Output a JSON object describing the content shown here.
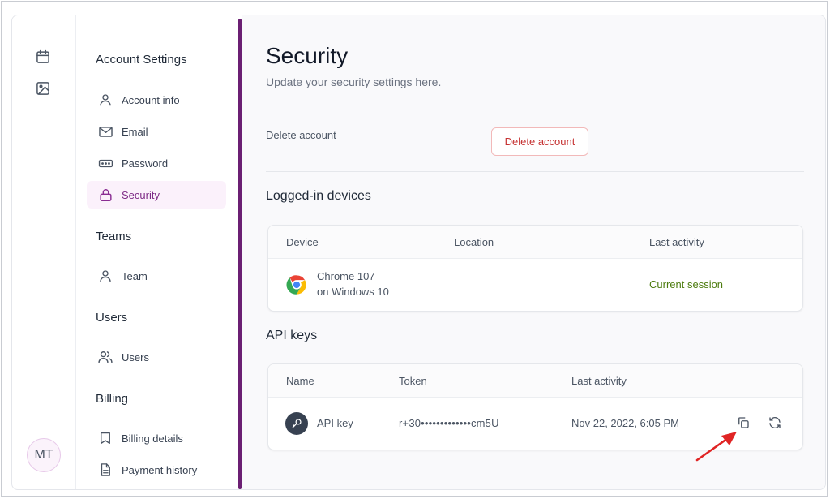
{
  "sidebar": {
    "sections": [
      {
        "heading": "Account Settings",
        "items": [
          {
            "label": "Account info",
            "icon": "user-icon"
          },
          {
            "label": "Email",
            "icon": "mail-icon"
          },
          {
            "label": "Password",
            "icon": "password-icon"
          },
          {
            "label": "Security",
            "icon": "lock-icon",
            "active": true
          }
        ]
      },
      {
        "heading": "Teams",
        "items": [
          {
            "label": "Team",
            "icon": "user-icon"
          }
        ]
      },
      {
        "heading": "Users",
        "items": [
          {
            "label": "Users",
            "icon": "users-icon"
          }
        ]
      },
      {
        "heading": "Billing",
        "items": [
          {
            "label": "Billing details",
            "icon": "bookmark-icon"
          },
          {
            "label": "Payment history",
            "icon": "document-icon"
          }
        ]
      }
    ]
  },
  "rail": {
    "avatar_initials": "MT"
  },
  "main": {
    "title": "Security",
    "subtitle": "Update your security settings here.",
    "delete_label": "Delete account",
    "delete_button": "Delete account",
    "devices": {
      "title": "Logged-in devices",
      "columns": [
        "Device",
        "Location",
        "Last activity"
      ],
      "rows": [
        {
          "device_line1": "Chrome 107",
          "device_line2": "on Windows 10",
          "location": "",
          "last_activity": "Current session"
        }
      ]
    },
    "api_keys": {
      "title": "API keys",
      "columns": [
        "Name",
        "Token",
        "Last activity"
      ],
      "rows": [
        {
          "name": "API key",
          "token": "r+30•••••••••••••cm5U",
          "last_activity": "Nov 22, 2022, 6:05 PM"
        }
      ]
    }
  },
  "colors": {
    "accent": "#6b1f73",
    "active_bg": "#fbf1fb",
    "danger": "#c53030",
    "success": "#4d7c0f",
    "annotation_arrow": "#e02424"
  }
}
